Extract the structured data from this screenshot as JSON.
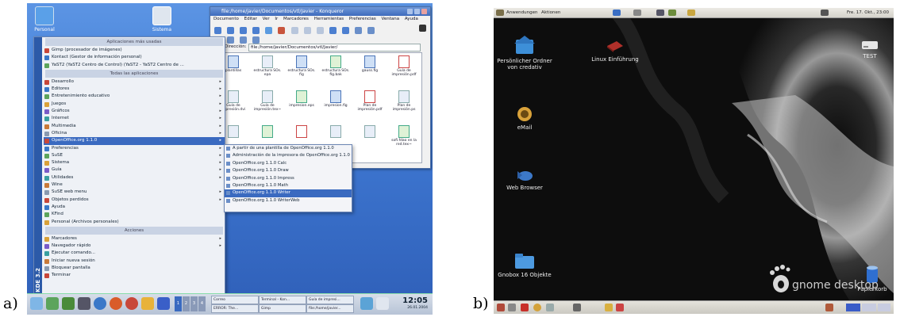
{
  "labels": {
    "a": "a)",
    "b": "b)"
  },
  "kde": {
    "desktop_icons": [
      {
        "label": "Personal",
        "icon": "home-folder-icon",
        "color": "#5aa0e8"
      },
      {
        "label": "Sistema",
        "icon": "computer-icon",
        "color": "#dfe6ef"
      }
    ],
    "kmenu": {
      "side_text": "KDE 3.2",
      "sections": {
        "most_used": "Aplicaciones más usadas",
        "all": "Todas las aplicaciones",
        "actions": "Acciones"
      },
      "most_used": [
        "Gimp (procesador de imágenes)",
        "Kontact (Gestor de información personal)",
        "YaST2 (YaST2 Centro de Control) (YaST2 - YaST2 Centro de ..."
      ],
      "apps": [
        "Desarrollo",
        "Editores",
        "Entretenimiento educativo",
        "Juegos",
        "Gráficos",
        "Internet",
        "Multimedia",
        "Oficina",
        "OpenOffice.org 1.1.0",
        "Preferencias",
        "SuSE",
        "Sistema",
        "Guía",
        "Utilidades",
        "Wine",
        "SuSE web menu",
        "Objetos perdidos",
        "Ayuda",
        "KFind",
        "Personal (Archivos personales)"
      ],
      "apps_with_arrow": [
        true,
        true,
        true,
        true,
        true,
        true,
        true,
        true,
        true,
        true,
        true,
        true,
        true,
        true,
        false,
        true,
        true,
        false,
        false,
        false
      ],
      "selected_index": 8,
      "actions": [
        "Marcadores",
        "Navegador rápido",
        "Ejecutar comando...",
        "Iniciar nueva sesión",
        "Bloquear pantalla",
        "Terminar"
      ]
    },
    "submenu": {
      "items": [
        "A partir de una plantilla de OpenOffice.org 1.1.0",
        "Administración de la impresora de OpenOffice.org 1.1.0",
        "OpenOffice.org 1.1.0 Calc",
        "OpenOffice.org 1.1.0 Draw",
        "OpenOffice.org 1.1.0 Impress",
        "OpenOffice.org 1.1.0 Math",
        "OpenOffice.org 1.1.0 Writer",
        "OpenOffice.org 1.1.0 WriterWeb"
      ],
      "selected_index": 6
    },
    "konqueror": {
      "title": "file:/home/javier/Documentos/vtl/Javier - Konqueror",
      "menubar": [
        "Documento",
        "Editar",
        "Ver",
        "Ir",
        "Marcadores",
        "Herramientas",
        "Preferencias",
        "Ventana",
        "Ayuda"
      ],
      "address_label": "Dirección:",
      "address_value": "file:/home/javier/Documentos/vtl/Javier/",
      "files": [
        {
          "name": "plantillas",
          "kind": "blue"
        },
        {
          "name": "estructura SOs. epa",
          "kind": "plain"
        },
        {
          "name": "estructura SOs. fig",
          "kind": "blue"
        },
        {
          "name": "estructura SOs. fig.bak",
          "kind": "green"
        },
        {
          "name": "gauss.fig",
          "kind": "blue"
        },
        {
          "name": "Guía de impresión.pdf",
          "kind": "pdf"
        },
        {
          "name": "Guía de impresión.dvi",
          "kind": "plain"
        },
        {
          "name": "Guía de impresión.tex~",
          "kind": "plain"
        },
        {
          "name": "impresion.eps",
          "kind": "green"
        },
        {
          "name": "impresion.fig",
          "kind": "blue"
        },
        {
          "name": "Plan de impresión.pdf",
          "kind": "pdf"
        },
        {
          "name": "Plan de impresión.ps",
          "kind": "plain"
        },
        {
          "name": "",
          "kind": "plain"
        },
        {
          "name": "",
          "kind": "green"
        },
        {
          "name": "",
          "kind": "pdf"
        },
        {
          "name": "",
          "kind": "plain"
        },
        {
          "name": "",
          "kind": "plain"
        },
        {
          "name": "sofi.fdao en la red.tex~",
          "kind": "green"
        }
      ]
    },
    "taskbar": {
      "tasks": [
        "Correo",
        "Terminal - Kon...",
        "Guía de impresi...",
        "ERROR: The...",
        "Gimp",
        "file:/home/javier..."
      ],
      "pager": [
        "1",
        "2",
        "3",
        "4"
      ],
      "clock": "12:05",
      "date": "26.01.2004"
    }
  },
  "gnome": {
    "top_menus": [
      "Anwendungen",
      "Aktionen"
    ],
    "clock": "Fre. 17. Okt., 23:00",
    "desktop_icons": [
      {
        "label": "Persönlicher Ordner von credativ",
        "icon": "home-folder-icon"
      },
      {
        "label": "Linux Einführung",
        "icon": "book-icon"
      },
      {
        "label": "eMail",
        "icon": "email-icon"
      },
      {
        "label": "Web Browser",
        "icon": "web-browser-icon"
      },
      {
        "label": "Gnobox 16 Objekte",
        "icon": "folder-icon"
      },
      {
        "label": "TEST",
        "icon": "drive-icon"
      },
      {
        "label": "Papierkorb",
        "icon": "trash-icon"
      }
    ],
    "logo_text": "gnome desktop",
    "colors": {
      "panel": "#dcdad3",
      "background": "#111111",
      "logo": "#cccccc"
    }
  }
}
